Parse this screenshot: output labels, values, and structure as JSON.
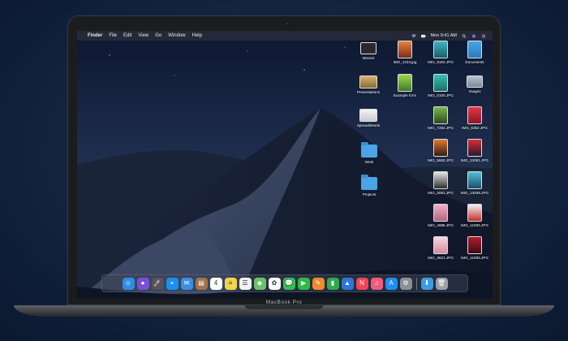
{
  "device": {
    "brand_label": "MacBook Pro"
  },
  "menubar": {
    "apple": "",
    "items": [
      "Finder",
      "File",
      "Edit",
      "View",
      "Go",
      "Window",
      "Help"
    ],
    "clock": "Mon 9:41 AM"
  },
  "desktop": {
    "icons": [
      {
        "label": "Movies",
        "kind": "folder-dark"
      },
      {
        "label": "IMG_1234.jpg",
        "kind": "photo"
      },
      {
        "label": "IMG_9102.JPG",
        "kind": "photo"
      },
      {
        "label": "Documents",
        "kind": "doc"
      },
      {
        "label": "Presentations",
        "kind": "stack"
      },
      {
        "label": "Example form",
        "kind": "photo"
      },
      {
        "label": "IMG_0100.JPG",
        "kind": "photo"
      },
      {
        "label": "Images",
        "kind": "folder-grey"
      },
      {
        "label": "Spreadsheets",
        "kind": "stack"
      },
      {
        "label": "IMG_7282.JPG",
        "kind": "photo"
      },
      {
        "label": "IMG_6352.JPG",
        "kind": "photo"
      },
      {
        "label": "Work",
        "kind": "folder"
      },
      {
        "label": "IMG_5663.JPG",
        "kind": "photo"
      },
      {
        "label": "IMG_13091.JPG",
        "kind": "photo"
      },
      {
        "label": "Projects",
        "kind": "folder"
      },
      {
        "label": "IMG_5061.JPG",
        "kind": "photo"
      },
      {
        "label": "IMG_13838.JPG",
        "kind": "photo"
      },
      {
        "label": "IMG_4985.JPG",
        "kind": "photo"
      },
      {
        "label": "IMG_11093.JPG",
        "kind": "photo"
      },
      {
        "label": "IMG_3621.JPG",
        "kind": "photo"
      },
      {
        "label": "IMG_11093.JPG",
        "kind": "photo"
      }
    ]
  },
  "dock": {
    "apps": [
      {
        "name": "finder-icon",
        "color": "#2f8de4",
        "glyph": "☺"
      },
      {
        "name": "siri-icon",
        "color": "#7a4fd8",
        "glyph": "●"
      },
      {
        "name": "launchpad-icon",
        "color": "#4b5563",
        "glyph": "🚀"
      },
      {
        "name": "safari-icon",
        "color": "#1b8ff0",
        "glyph": "⌖"
      },
      {
        "name": "mail-icon",
        "color": "#3a8ee6",
        "glyph": "✉"
      },
      {
        "name": "contacts-icon",
        "color": "#a0744a",
        "glyph": "▤"
      },
      {
        "name": "calendar-icon",
        "color": "#ffffff",
        "glyph": "4"
      },
      {
        "name": "notes-icon",
        "color": "#f2d54a",
        "glyph": "≡"
      },
      {
        "name": "reminders-icon",
        "color": "#f2f2f2",
        "glyph": "☰"
      },
      {
        "name": "maps-icon",
        "color": "#6cc16c",
        "glyph": "◆"
      },
      {
        "name": "photos-icon",
        "color": "#fafafa",
        "glyph": "✿"
      },
      {
        "name": "messages-icon",
        "color": "#30c04f",
        "glyph": "💬"
      },
      {
        "name": "facetime-icon",
        "color": "#2fb84a",
        "glyph": "▶"
      },
      {
        "name": "pages-icon",
        "color": "#f08a2a",
        "glyph": "✎"
      },
      {
        "name": "numbers-icon",
        "color": "#2cac4f",
        "glyph": "▮"
      },
      {
        "name": "keynote-icon",
        "color": "#2b78d8",
        "glyph": "▲"
      },
      {
        "name": "news-icon",
        "color": "#f24458",
        "glyph": "N"
      },
      {
        "name": "music-icon",
        "color": "#f35a7a",
        "glyph": "♫"
      },
      {
        "name": "app-store-icon",
        "color": "#1d8ff2",
        "glyph": "A"
      },
      {
        "name": "system-preferences-icon",
        "color": "#8a8f98",
        "glyph": "⚙"
      },
      {
        "name": "downloads-folder-icon",
        "color": "#3d9be4",
        "glyph": "⬇"
      },
      {
        "name": "trash-icon",
        "color": "#9aa0a8",
        "glyph": "🗑"
      }
    ]
  }
}
